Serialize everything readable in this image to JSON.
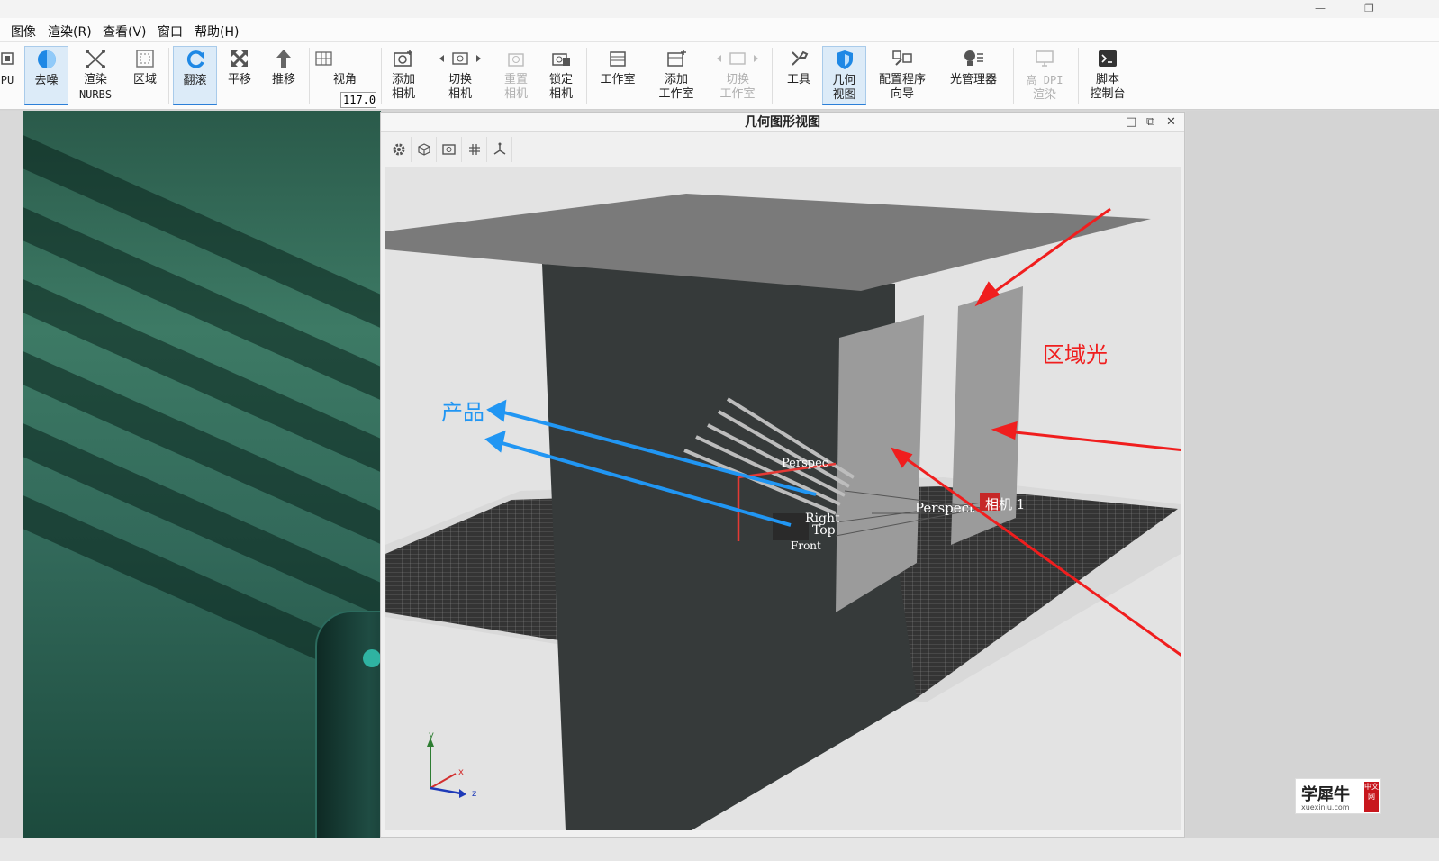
{
  "menu": [
    "图像",
    "渲染(R)",
    "查看(V)",
    "窗口",
    "帮助(H)"
  ],
  "toolbar": {
    "cpu_label": "PU",
    "denoise": "去噪",
    "render_nurbs": [
      "渲染",
      "NURBS"
    ],
    "region": "区域",
    "tumble": "翻滚",
    "pan": "平移",
    "dolly": "推移",
    "fov_value": "117.0",
    "fov_label": "视角",
    "add_camera": [
      "添加",
      "相机"
    ],
    "switch_camera": [
      "切换",
      "相机"
    ],
    "reset_camera": [
      "重置",
      "相机"
    ],
    "lock_camera": [
      "锁定",
      "相机"
    ],
    "studio": "工作室",
    "add_studio": [
      "添加",
      "工作室"
    ],
    "switch_studio": [
      "切换",
      "工作室"
    ],
    "tools": "工具",
    "geometry_view": [
      "几何",
      "视图"
    ],
    "config_wizard": [
      "配置程序",
      "向导"
    ],
    "light_manager": "光管理器",
    "hidpi": [
      "高 DPI",
      "渲染"
    ],
    "script_console": [
      "脚本",
      "控制台"
    ]
  },
  "panel": {
    "title": "几何图形视图"
  },
  "viewport": {
    "annotation_product": "产品",
    "annotation_area_light": "区域光",
    "label_perspective": "Perspect",
    "label_camera": "相机 1",
    "label_persp_top": "Perspec",
    "label_right": "Right",
    "label_top": "Top",
    "label_front": "Front",
    "axis_y": "y",
    "axis_x": "x",
    "axis_z": "z"
  },
  "watermark": {
    "main": "学犀牛",
    "sub": "xuexiniu.com",
    "badge": "中文网"
  },
  "colors": {
    "annotation_red": "#f01e1e",
    "annotation_blue": "#2196f3",
    "active_tool": "#2b7fd8"
  }
}
